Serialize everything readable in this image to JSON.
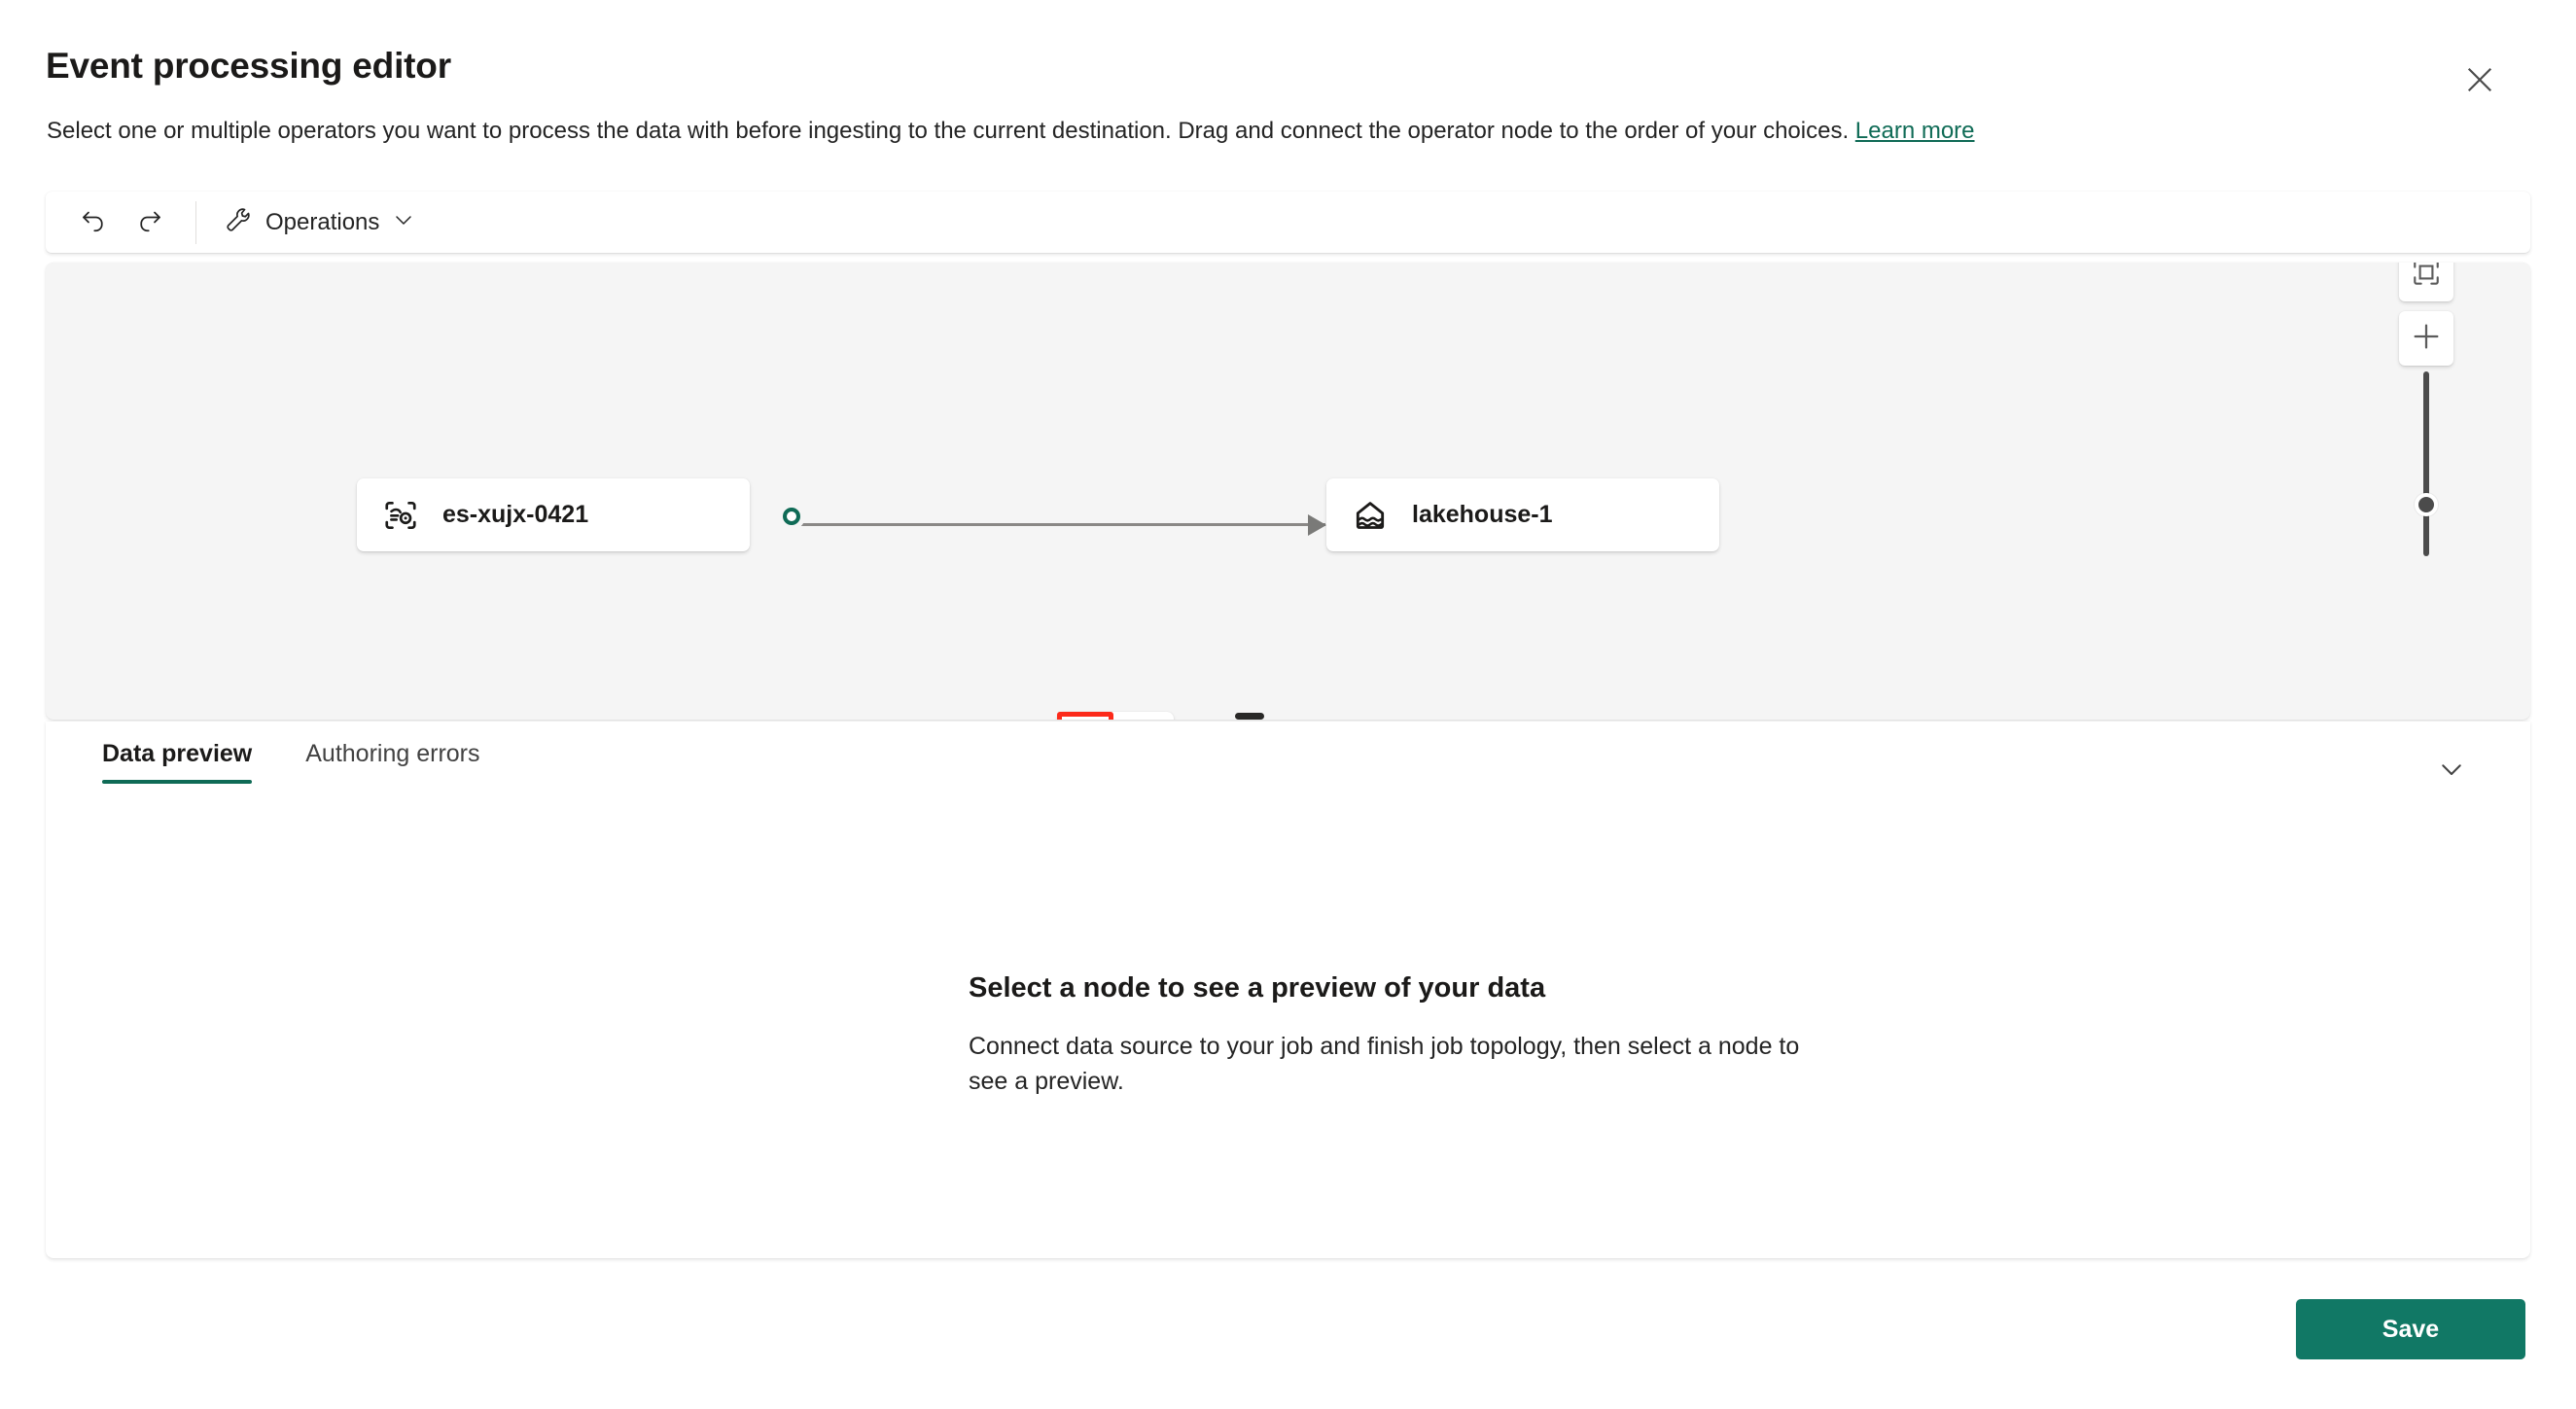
{
  "header": {
    "title": "Event processing editor",
    "subtitle_text": "Select one or multiple operators you want to process the data with before ingesting to the current destination. Drag and connect the operator node to the order of your choices.",
    "learn_more_label": "Learn more",
    "close_icon": "close-icon"
  },
  "toolbar": {
    "undo_icon": "undo-icon",
    "redo_icon": "redo-icon",
    "operations_label": "Operations",
    "operations_icon": "wrench-icon",
    "operations_chevron_icon": "chevron-down-icon"
  },
  "canvas": {
    "nodes": [
      {
        "id": "source",
        "label": "es-xujx-0421",
        "icon": "eventstream-icon"
      },
      {
        "id": "destination",
        "label": "lakehouse-1",
        "icon": "lakehouse-icon"
      }
    ],
    "edge": {
      "from": "es-xujx-0421",
      "to": "lakehouse-1",
      "arrow_icon": "arrow-right-icon"
    },
    "edge_tools": {
      "add_icon": "plus-circle-icon",
      "delete_icon": "trash-icon",
      "highlight_color": "#fc2a1a",
      "add_color": "#0f6b56",
      "delete_color": "#117865"
    },
    "zoom_controls": {
      "fit_icon": "fit-to-screen-icon",
      "zoom_in_icon": "plus-icon",
      "slider_icon": "zoom-slider"
    },
    "drag_handle": "resize-handle"
  },
  "pane": {
    "tabs": [
      {
        "label": "Data preview",
        "active": true
      },
      {
        "label": "Authoring errors",
        "active": false
      }
    ],
    "collapse_icon": "chevron-down-icon",
    "empty_state": {
      "title": "Select a node to see a preview of your data",
      "description": "Connect data source to your job and finish job topology, then select a node to see a preview."
    }
  },
  "footer": {
    "save_label": "Save",
    "save_color": "#117865"
  },
  "theme": {
    "accent": "#0f6b56",
    "link": "#0f6b56",
    "canvas_bg": "#f5f5f5",
    "text": "#242424"
  }
}
